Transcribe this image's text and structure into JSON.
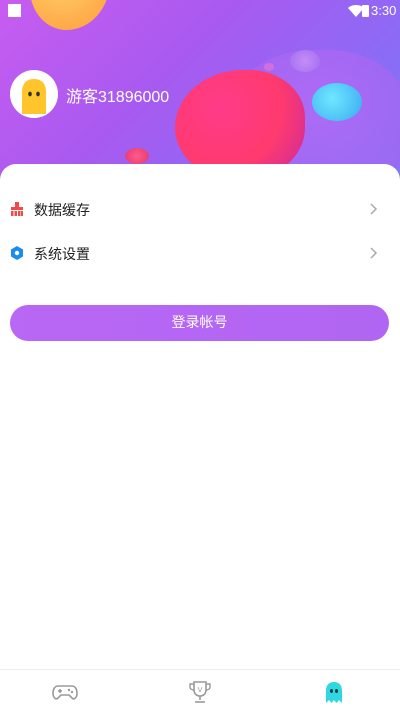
{
  "status_bar": {
    "time": "3:30"
  },
  "profile": {
    "username": "游客31896000"
  },
  "menu": [
    {
      "label": "数据缓存",
      "icon": "broom-icon"
    },
    {
      "label": "系统设置",
      "icon": "settings-hexagon-icon"
    }
  ],
  "login_button": {
    "label": "登录帐号"
  },
  "bottom_nav": [
    {
      "icon": "gamepad-icon",
      "active": false
    },
    {
      "icon": "trophy-icon",
      "active": false
    },
    {
      "icon": "ghost-icon",
      "active": true
    }
  ],
  "colors": {
    "accent": "#b967f5",
    "active_tab": "#2fd7e0",
    "inactive_tab": "#9a9a9a",
    "cache_icon": "#f04a4a",
    "settings_icon": "#1a8cf0"
  }
}
